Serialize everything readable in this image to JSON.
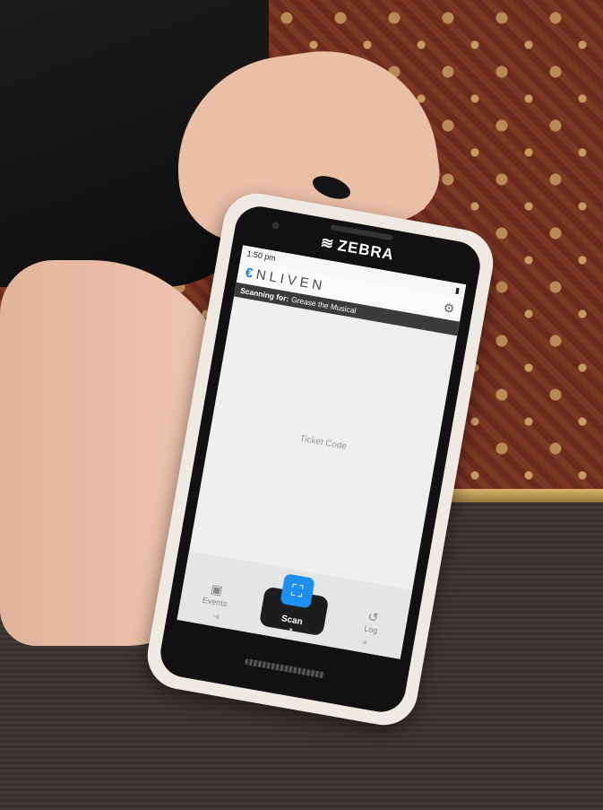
{
  "device": {
    "brand": "ZEBRA"
  },
  "status": {
    "time": "1:50 pm"
  },
  "app": {
    "logo_text": "NLIVEN",
    "scanning_label": "Scanning for:",
    "event_name": "Grease the Musical",
    "placeholder": "Ticket Code"
  },
  "tabs": {
    "events": "Events",
    "scan": "Scan",
    "log": "Log"
  },
  "colors": {
    "accent": "#1e8ff0",
    "header_bar": "#3b3b3b"
  }
}
